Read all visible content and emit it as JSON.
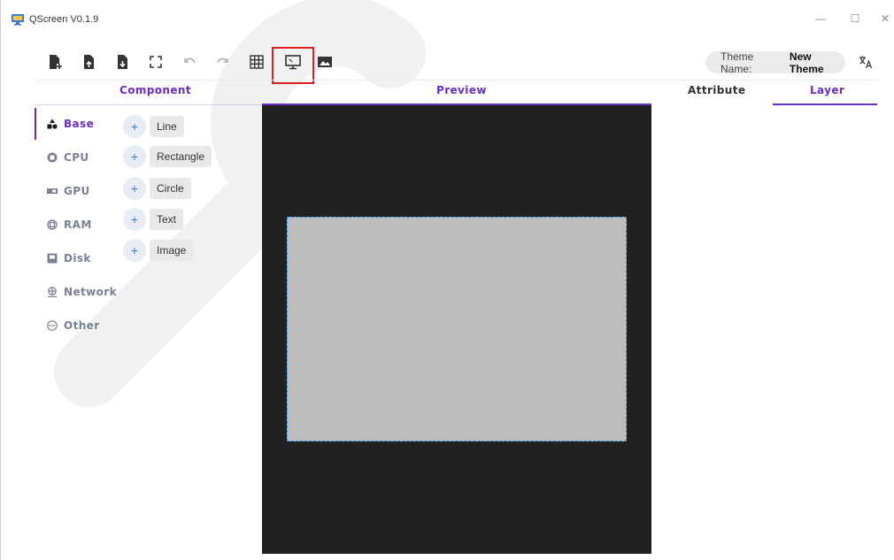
{
  "window": {
    "title": "QScreen V0.1.9"
  },
  "titlebar_controls": {
    "minimize": "—",
    "maximize": "☐",
    "close": "✕"
  },
  "toolbar": {
    "buttons": [
      {
        "name": "new-file-icon"
      },
      {
        "name": "import-file-icon"
      },
      {
        "name": "export-file-icon"
      },
      {
        "name": "fullscreen-icon"
      },
      {
        "name": "undo-icon"
      },
      {
        "name": "redo-icon"
      },
      {
        "name": "grid-icon"
      },
      {
        "name": "preview-screen-icon",
        "highlighted": true
      },
      {
        "name": "image-icon"
      }
    ],
    "theme_label": "Theme Name:",
    "theme_value": "New Theme",
    "translate_icon": "translate-icon"
  },
  "panels": {
    "component": "Component",
    "preview": "Preview",
    "attribute": "Attribute",
    "layer": "Layer"
  },
  "sidebar": {
    "items": [
      {
        "label": "Base",
        "icon": "shapes-icon",
        "active": true
      },
      {
        "label": "CPU",
        "icon": "cpu-icon",
        "active": false
      },
      {
        "label": "GPU",
        "icon": "gpu-icon",
        "active": false
      },
      {
        "label": "RAM",
        "icon": "ram-icon",
        "active": false
      },
      {
        "label": "Disk",
        "icon": "disk-icon",
        "active": false
      },
      {
        "label": "Network",
        "icon": "network-icon",
        "active": false
      },
      {
        "label": "Other",
        "icon": "other-icon",
        "active": false
      }
    ]
  },
  "components": {
    "add_symbol": "+",
    "items": [
      {
        "label": "Line"
      },
      {
        "label": "Rectangle"
      },
      {
        "label": "Circle"
      },
      {
        "label": "Text"
      },
      {
        "label": "Image"
      }
    ]
  },
  "colors": {
    "accent": "#6a2fc2",
    "canvas_bg": "#212121",
    "element_fill": "#bdbdbd",
    "selection_border": "#2f8fe0",
    "highlight_box": "#e02020"
  }
}
